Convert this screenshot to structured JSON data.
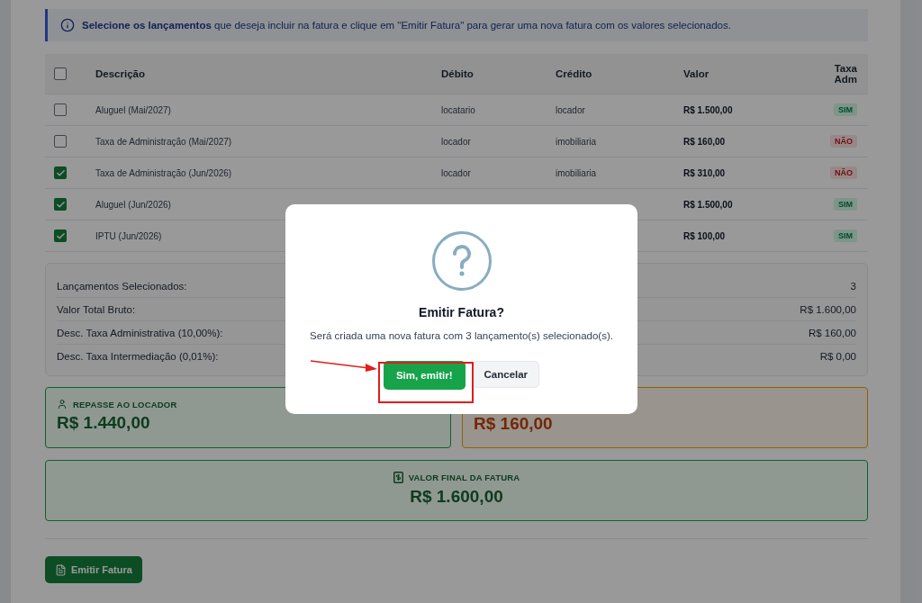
{
  "notice": "**Selecione os lançamentos** que deseja incluir na fatura e clique em \"Emitir Fatura\" para gerar uma nova fatura com os valores selecionados.",
  "table": {
    "select_all": {
      "checked": false
    },
    "columns": [
      "Descrição",
      "Débito",
      "Crédito",
      "Valor",
      "Taxa Adm"
    ],
    "rows": [
      {
        "checked": false,
        "description": "Aluguel (Mai/2027)",
        "debit": "locatario",
        "credit": "locador",
        "value": "R$ 1.500,00",
        "fee": {
          "label": "SIM",
          "kind": "yes"
        }
      },
      {
        "checked": false,
        "description": "Taxa de Administração (Mai/2027)",
        "debit": "locador",
        "credit": "imobiliaria",
        "value": "R$ 160,00",
        "fee": {
          "label": "NÃO",
          "kind": "no"
        }
      },
      {
        "checked": true,
        "description": "Taxa de Administração (Jun/2026)",
        "debit": "locador",
        "credit": "imobiliaria",
        "value": "R$ 310,00",
        "fee": {
          "label": "NÃO",
          "kind": "no"
        }
      },
      {
        "checked": true,
        "description": "Aluguel (Jun/2026)",
        "value": "R$ 1.500,00",
        "fee": {
          "label": "SIM",
          "kind": "yes"
        }
      },
      {
        "checked": true,
        "description": "IPTU (Jun/2026)",
        "value": "R$ 100,00",
        "fee": {
          "label": "SIM",
          "kind": "yes"
        }
      }
    ]
  },
  "summary": [
    {
      "label": "Lançamentos Selecionados:",
      "value": "3"
    },
    {
      "label": "Valor Total Bruto:",
      "value": "R$ 1.600,00"
    },
    {
      "label": "Desc. Taxa Administrativa (10,00%):",
      "value": "R$ 160,00"
    },
    {
      "label": "Desc. Taxa Intermediação (0,01%):",
      "value": "R$ 0,00"
    }
  ],
  "cards": [
    {
      "kind": "green",
      "label": "REPASSE AO LOCADOR",
      "amount": "R$ 1.440,00"
    },
    {
      "kind": "orange",
      "amount": "R$ 160,00"
    }
  ],
  "final_card": {
    "label": "VALOR FINAL DA FATURA",
    "amount": "R$ 1.600,00"
  },
  "action_button": "Emitir Fatura",
  "dialog": {
    "title": "Emitir Fatura?",
    "message": "Será criada uma nova fatura com 3 lançamento(s) selecionado(s).",
    "confirm": "Sim, emitir!",
    "cancel": "Cancelar"
  }
}
